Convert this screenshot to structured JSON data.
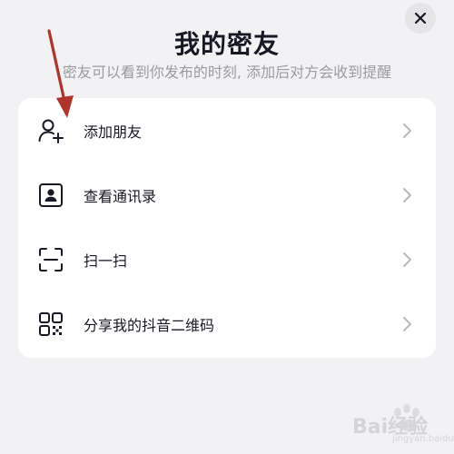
{
  "header": {
    "title": "我的密友",
    "subtitle": "密友可以看到你发布的时刻, 添加后对方会收到提醒",
    "close_icon": "close-icon"
  },
  "menu": {
    "items": [
      {
        "label": "添加朋友",
        "icon": "add-user-icon"
      },
      {
        "label": "查看通讯录",
        "icon": "contacts-icon"
      },
      {
        "label": "扫一扫",
        "icon": "scan-icon"
      },
      {
        "label": "分享我的抖音二维码",
        "icon": "qr-code-icon"
      }
    ]
  },
  "annotation": {
    "arrow_color": "#b0342a"
  },
  "watermark": {
    "text": "Bai经验",
    "sub": "jingyan.baidu.com"
  },
  "colors": {
    "background": "#f2f2f4",
    "card": "#ffffff",
    "text": "#161823",
    "subtext": "#9a9ba0",
    "chevron": "#b8b9bd"
  }
}
